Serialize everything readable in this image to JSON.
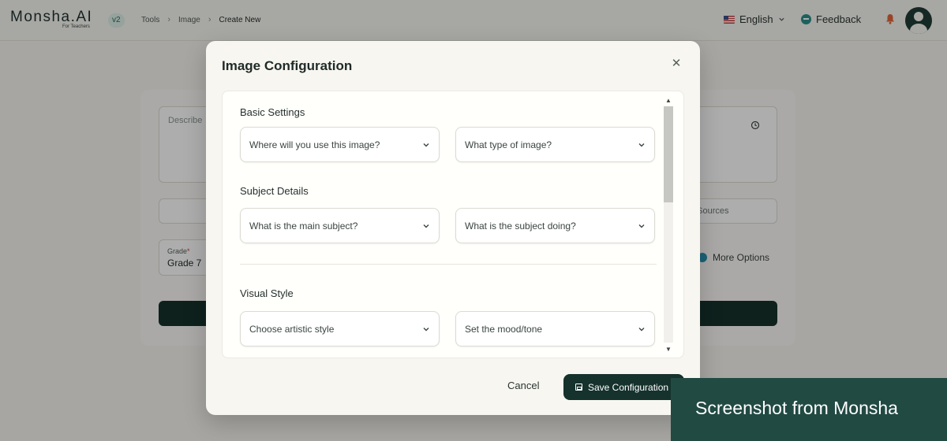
{
  "header": {
    "logo": "Monsha.AI",
    "logo_sub": "For Teachers",
    "version": "v2",
    "breadcrumb": [
      "Tools",
      "Image",
      "Create New"
    ],
    "language": "English",
    "feedback": "Feedback"
  },
  "background": {
    "description_placeholder": "Describe",
    "sources_label": "e Sources",
    "grade_label": "Grade",
    "grade_value": "Grade 7",
    "more_options": "More Options"
  },
  "modal": {
    "title": "Image Configuration",
    "sections": {
      "basic": {
        "title": "Basic Settings",
        "usage_select": "Where will you use this image?",
        "type_select": "What type of image?"
      },
      "subject": {
        "title": "Subject Details",
        "subject_select": "What is the main subject?",
        "action_select": "What is the subject doing?"
      },
      "visual": {
        "title": "Visual Style",
        "style_select": "Choose artistic style",
        "mood_select": "Set the mood/tone"
      }
    },
    "cancel_label": "Cancel",
    "save_label": "Save Configuration"
  },
  "watermark": "Screenshot from Monsha"
}
